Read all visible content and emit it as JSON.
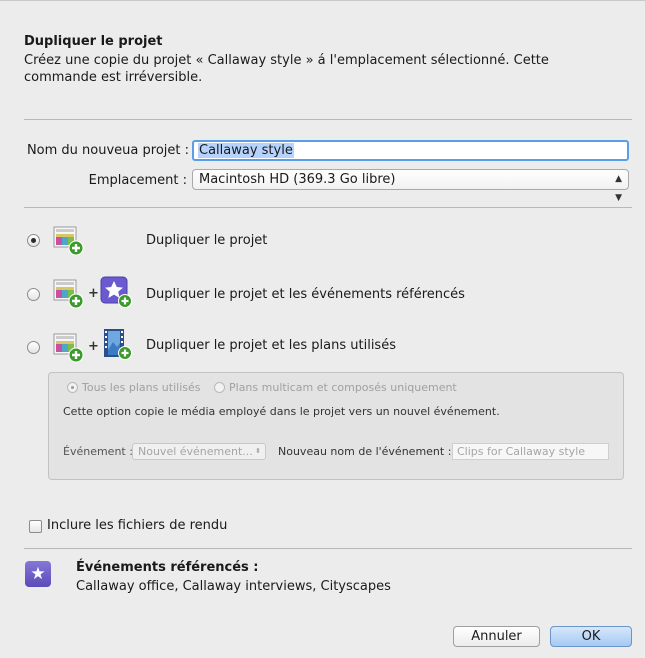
{
  "dialog": {
    "title": "Dupliquer le projet",
    "description": "Créez une copie du projet « Callaway style » á l'emplacement sélectionné. Cette commande est irréversible."
  },
  "form": {
    "name_label": "Nom du nouveua projet :",
    "name_value": "Callaway style",
    "location_label": "Emplacement :",
    "location_value": "Macintosh HD   (369.3  Go libre)"
  },
  "options": [
    {
      "label": "Dupliquer le projet",
      "selected": true
    },
    {
      "label": "Dupliquer le projet et les événements référencés",
      "selected": false
    },
    {
      "label": "Dupliquer le projet et les plans utilisés",
      "selected": false
    }
  ],
  "plus_sign": "+",
  "subpanel": {
    "radio_all": "Tous les plans utilisés",
    "radio_multicam": "Plans multicam et composés uniquement",
    "info": "Cette option copie le média employé dans le projet vers un nouvel événement.",
    "event_label": "Événement :",
    "event_value": "Nouvel événement...",
    "new_name_label": "Nouveau nom de l'événement :",
    "new_name_value": "Clips for Callaway style"
  },
  "render_files_checkbox": "Inclure les fichiers de rendu",
  "referenced_events": {
    "title": "Événements référencés :",
    "list": "Callaway office, Callaway interviews, Cityscapes"
  },
  "buttons": {
    "cancel": "Annuler",
    "ok": "OK"
  },
  "icons": {
    "project": "project-clip-icon",
    "event": "star-event-icon",
    "film": "film-strip-icon",
    "badge": "star-badge-icon"
  },
  "colors": {
    "accent_blue": "#5b9de8",
    "event_purple": "#6a5acd",
    "add_green": "#3a9a2a"
  }
}
